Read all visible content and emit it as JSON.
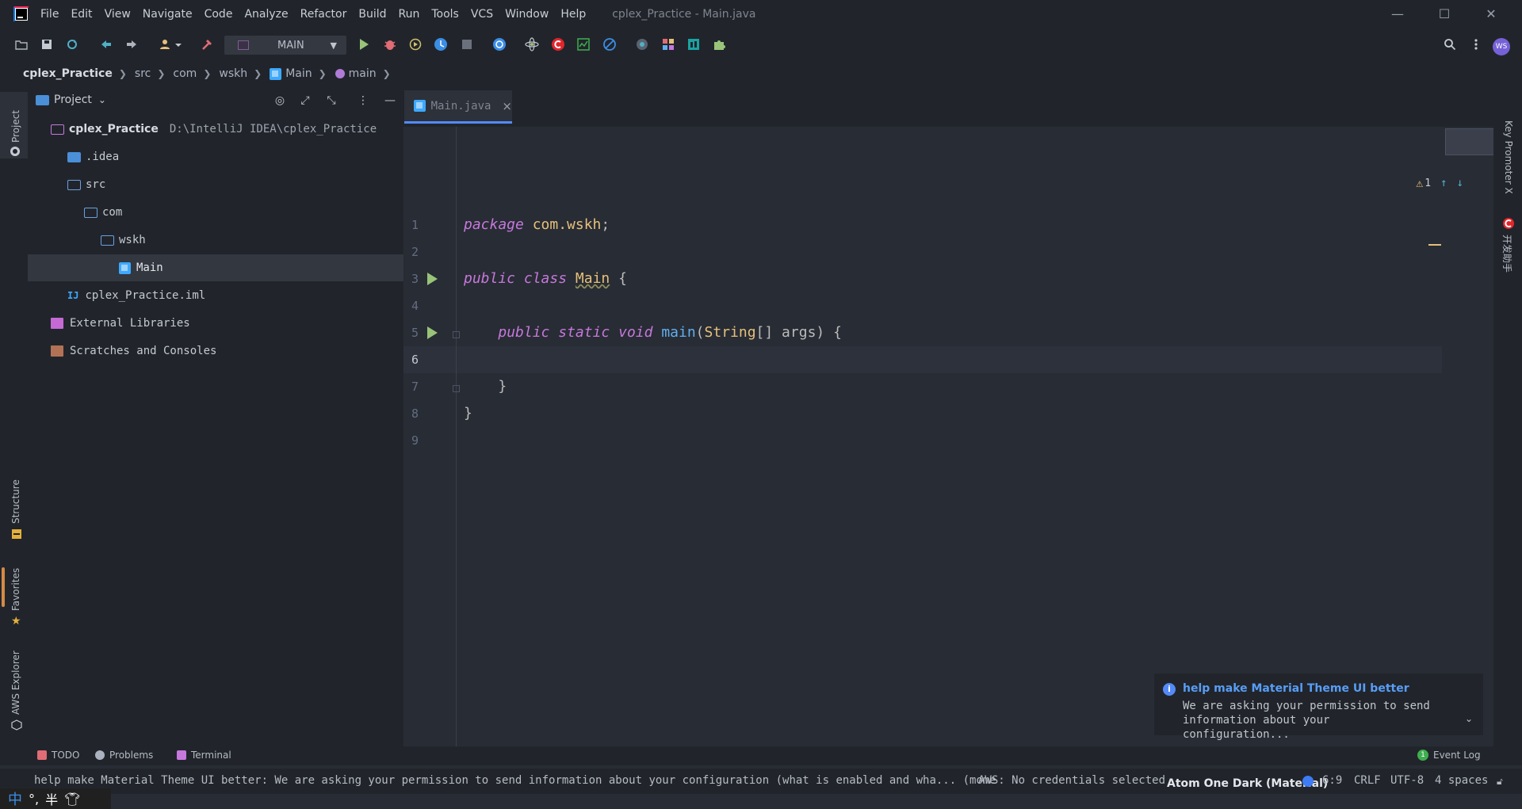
{
  "window": {
    "title": "cplex_Practice - Main.java",
    "minimize": "—",
    "maximize": "☐",
    "close": "✕"
  },
  "menu": [
    "File",
    "Edit",
    "View",
    "Navigate",
    "Code",
    "Analyze",
    "Refactor",
    "Build",
    "Run",
    "Tools",
    "VCS",
    "Window",
    "Help"
  ],
  "toolbar": {
    "run_config": "MAIN",
    "avatar": "WS"
  },
  "breadcrumb": [
    "cplex_Practice",
    "src",
    "com",
    "wskh",
    "Main",
    "main"
  ],
  "project_panel": {
    "title": "Project",
    "tree": [
      {
        "label": "cplex_Practice",
        "path": "D:\\IntelliJ IDEA\\cplex_Practice"
      },
      {
        "label": ".idea"
      },
      {
        "label": "src"
      },
      {
        "label": "com"
      },
      {
        "label": "wskh"
      },
      {
        "label": "Main"
      },
      {
        "label": "cplex_Practice.iml"
      },
      {
        "label": "External Libraries"
      },
      {
        "label": "Scratches and Consoles"
      }
    ]
  },
  "left_stripe": {
    "project": "Project",
    "structure": "Structure",
    "favorites": "Favorites",
    "aws": "AWS Explorer"
  },
  "right_stripe": {
    "key_promoter": "Key Promoter X",
    "dev_helper": "开发助手"
  },
  "editor": {
    "tab": "Main.java",
    "warnings": "1",
    "current_line": 6,
    "line_numbers": [
      "1",
      "2",
      "3",
      "4",
      "5",
      "6",
      "7",
      "8",
      "9"
    ]
  },
  "notification": {
    "title": "help make Material Theme UI better",
    "body": "We are asking your permission to send information about your configuration..."
  },
  "bottom_tabs": {
    "todo": "TODO",
    "problems": "Problems",
    "terminal": "Terminal",
    "event_log": "Event Log",
    "event_count": "1"
  },
  "statusbar": {
    "message": "help make Material Theme UI better: We are asking your permission to send information about your configuration (what is enabled and wha... (mome",
    "aws": "AWS: No credentials selected",
    "theme": "Atom One Dark (Material)",
    "position": "6:9",
    "line_sep": "CRLF",
    "encoding": "UTF-8",
    "indent": "4 spaces"
  },
  "colors": {
    "accent": "#528bff",
    "keyword": "#c678dd",
    "class": "#e5c07b",
    "function": "#61afef",
    "run": "#98c379"
  }
}
